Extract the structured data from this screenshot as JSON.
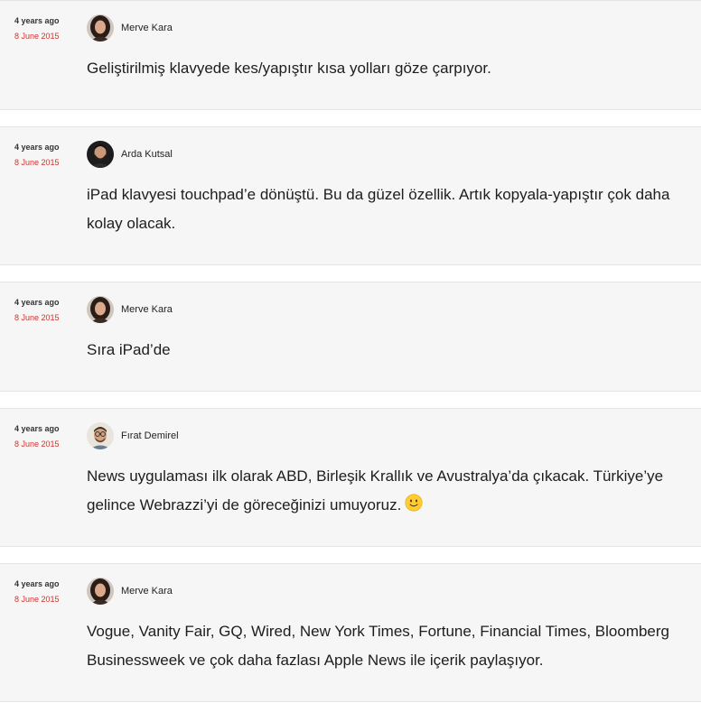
{
  "comments": [
    {
      "time_ago": "4 years ago",
      "date": "8 June 2015",
      "author": "Merve Kara",
      "text": "Geliştirilmiş klavyede kes/yapıştır kısa yolları göze çarpıyor."
    },
    {
      "time_ago": "4 years ago",
      "date": "8 June 2015",
      "author": "Arda Kutsal",
      "text": "iPad klavyesi touchpad’e dönüştü. Bu da güzel özellik. Artık kopyala-yapıştır çok daha kolay olacak."
    },
    {
      "time_ago": "4 years ago",
      "date": "8 June 2015",
      "author": "Merve Kara",
      "text": "Sıra iPad’de"
    },
    {
      "time_ago": "4 years ago",
      "date": "8 June 2015",
      "author": "Fırat Demirel",
      "text": "News uygulaması ilk olarak ABD, Birleşik Krallık ve Avustralya’da çıkacak. Türkiye’ye gelince Webrazzi’yi de göreceğinizi umuyoruz."
    },
    {
      "time_ago": "4 years ago",
      "date": "8 June 2015",
      "author": "Merve Kara",
      "text": "Vogue, Vanity Fair, GQ, Wired, New York Times, Fortune, Financial Times, Bloomberg Businessweek ve çok daha fazlası Apple News ile içerik paylaşıyor."
    }
  ],
  "icons": {
    "avatar_merve": "avatar-woman-dark-hair",
    "avatar_arda": "avatar-man-dark",
    "avatar_firat": "avatar-man-glasses",
    "emoji": "slightly-smiling-face-emoji"
  },
  "colors": {
    "card_background": "#f6f6f6",
    "date_text": "#d0312d",
    "body_text": "#1d1d1d",
    "emoji_yellow": "#ffcc33"
  }
}
